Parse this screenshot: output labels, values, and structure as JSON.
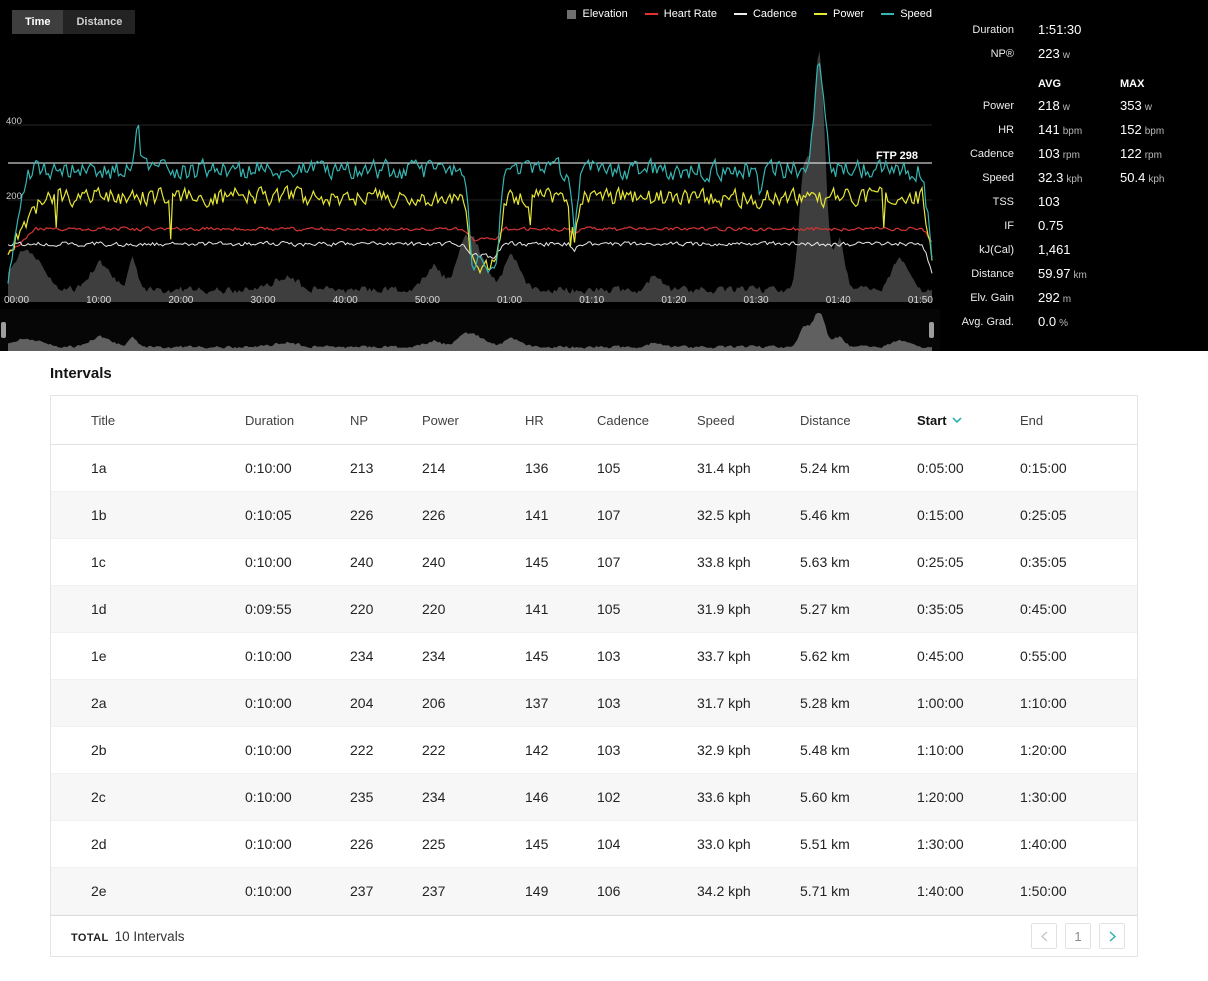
{
  "top_bar": {
    "time_label": "Time",
    "distance_label": "Distance"
  },
  "legend": [
    {
      "label": "Elevation",
      "color": "#6f6f6f",
      "swatch": "square"
    },
    {
      "label": "Heart Rate",
      "color": "#e03232",
      "swatch": "line"
    },
    {
      "label": "Cadence",
      "color": "#ededed",
      "swatch": "line"
    },
    {
      "label": "Power",
      "color": "#e6e635",
      "swatch": "line"
    },
    {
      "label": "Speed",
      "color": "#35b5b2",
      "swatch": "line"
    }
  ],
  "chart": {
    "ftp_label": "FTP 298",
    "y_ticks": [
      "400",
      "200"
    ],
    "x_ticks": [
      "00:00",
      "10:00",
      "20:00",
      "30:00",
      "40:00",
      "50:00",
      "01:00",
      "01:10",
      "01:20",
      "01:30",
      "01:40",
      "01:50"
    ]
  },
  "chart_data": {
    "type": "line",
    "x_axis": {
      "mode": "time",
      "ticks": [
        "00:00",
        "10:00",
        "20:00",
        "30:00",
        "40:00",
        "50:00",
        "01:00",
        "01:10",
        "01:20",
        "01:30",
        "01:40",
        "01:50"
      ],
      "duration": "1:51:30"
    },
    "y_axis": {
      "ticks": [
        400,
        200
      ],
      "range": [
        0,
        440
      ]
    },
    "ftp": 298,
    "series": [
      {
        "name": "Power",
        "avg": 218,
        "max": 353,
        "unit": "w",
        "color": "#e6e635"
      },
      {
        "name": "Heart Rate",
        "avg": 141,
        "max": 152,
        "unit": "bpm",
        "color": "#e03232"
      },
      {
        "name": "Cadence",
        "avg": 103,
        "max": 122,
        "unit": "rpm",
        "color": "#ededed"
      },
      {
        "name": "Speed",
        "avg": 32.3,
        "max": 50.4,
        "unit": "kph",
        "color": "#35b5b2"
      },
      {
        "name": "Elevation",
        "gain": 292,
        "unit": "m",
        "color": "#6f6f6f"
      }
    ],
    "legend_position": "top-right",
    "grid": true
  },
  "chart_render": {
    "main": [
      {
        "name": "elevation",
        "area": true,
        "color": "#8a8a8a",
        "opacity": 0.45,
        "seed": 11,
        "noise": 5,
        "base": 290,
        "spikes": [
          {
            "at": 0.02,
            "peak": 40,
            "w": 0.022
          },
          {
            "at": 0.1,
            "peak": 26,
            "w": 0.016
          },
          {
            "at": 0.135,
            "peak": 30,
            "w": 0.007
          },
          {
            "at": 0.3,
            "peak": 12,
            "w": 0.02
          },
          {
            "at": 0.46,
            "peak": 24,
            "w": 0.012
          },
          {
            "at": 0.5,
            "peak": 55,
            "w": 0.018
          },
          {
            "at": 0.545,
            "peak": 35,
            "w": 0.012
          },
          {
            "at": 0.7,
            "peak": 14,
            "w": 0.01
          },
          {
            "at": 0.862,
            "peak": 120,
            "w": 0.008
          },
          {
            "at": 0.878,
            "peak": 235,
            "w": 0.009
          },
          {
            "at": 0.9,
            "peak": 50,
            "w": 0.008
          },
          {
            "at": 0.965,
            "peak": 30,
            "w": 0.012
          }
        ]
      },
      {
        "name": "heart-rate",
        "color": "#d23434",
        "width": 1.2,
        "seed": 21,
        "noise": 2.5,
        "base": 229,
        "ramps": [
          {
            "to": 0.03,
            "drop": 25
          }
        ],
        "ends": [
          {
            "from": 0.99,
            "drop": 12
          }
        ],
        "dips": [
          {
            "from": 0.493,
            "to": 0.538,
            "drop": 11
          },
          {
            "from": 0.606,
            "to": 0.62,
            "drop": 7
          }
        ]
      },
      {
        "name": "cadence",
        "color": "#e8e8e8",
        "width": 1,
        "seed": 31,
        "noise": 3,
        "base": 244,
        "ends": [
          {
            "from": 0.99,
            "drop": 28
          }
        ],
        "dips": [
          {
            "from": 0.493,
            "to": 0.538,
            "drop": 12
          },
          {
            "from": 0.606,
            "to": 0.62,
            "drop": 9
          }
        ]
      },
      {
        "name": "power",
        "color": "#e6e635",
        "width": 1.2,
        "seed": 41,
        "noise": 12,
        "base": 197,
        "downspike": 0.012,
        "ramps": [
          {
            "to": 0.04,
            "drop": 52
          }
        ],
        "ends": [
          {
            "from": 0.99,
            "drop": 65
          }
        ],
        "dips": [
          {
            "from": 0.493,
            "to": 0.538,
            "drop": 70
          },
          {
            "from": 0.606,
            "to": 0.62,
            "drop": 65
          },
          {
            "from": 0.81,
            "to": 0.818,
            "drop": 45
          }
        ]
      },
      {
        "name": "speed",
        "color": "#35b5b2",
        "width": 1.2,
        "seed": 51,
        "noise": 13,
        "base": 170,
        "spikes": [
          {
            "at": 0.878,
            "peak": 108,
            "w": 0.008
          },
          {
            "at": 0.14,
            "peak": 40,
            "w": 0.004
          }
        ],
        "ramps": [
          {
            "to": 0.02,
            "drop": 120
          }
        ],
        "ends": [
          {
            "from": 0.99,
            "drop": 85
          }
        ],
        "dips": [
          {
            "from": 0.493,
            "to": 0.538,
            "drop": 95
          },
          {
            "from": 0.606,
            "to": 0.62,
            "drop": 85
          },
          {
            "from": 0.81,
            "to": 0.818,
            "drop": 60
          }
        ]
      }
    ],
    "minimap": [
      {
        "name": "elevation-mini",
        "area": true,
        "color": "#6a6a6a",
        "opacity": 0.9,
        "seed": 11,
        "noise": 2,
        "base": 38,
        "spikes": [
          {
            "at": 0.02,
            "peak": 8,
            "w": 0.022
          },
          {
            "at": 0.1,
            "peak": 10,
            "w": 0.016
          },
          {
            "at": 0.135,
            "peak": 9,
            "w": 0.007
          },
          {
            "at": 0.3,
            "peak": 4,
            "w": 0.02
          },
          {
            "at": 0.46,
            "peak": 6,
            "w": 0.012
          },
          {
            "at": 0.5,
            "peak": 14,
            "w": 0.018
          },
          {
            "at": 0.545,
            "peak": 9,
            "w": 0.012
          },
          {
            "at": 0.7,
            "peak": 4,
            "w": 0.01
          },
          {
            "at": 0.862,
            "peak": 20,
            "w": 0.008
          },
          {
            "at": 0.878,
            "peak": 36,
            "w": 0.009
          },
          {
            "at": 0.9,
            "peak": 10,
            "w": 0.008
          },
          {
            "at": 0.965,
            "peak": 6,
            "w": 0.012
          }
        ]
      }
    ]
  },
  "stats": {
    "rows_top": [
      {
        "label": "Duration",
        "value": "1:51:30",
        "unit": ""
      },
      {
        "label": "NP®",
        "value": "223",
        "unit": "w"
      }
    ],
    "avg_header": "AVG",
    "max_header": "MAX",
    "avgmax_rows": [
      {
        "label": "Power",
        "avg": "218",
        "avg_unit": "w",
        "max": "353",
        "max_unit": "w"
      },
      {
        "label": "HR",
        "avg": "141",
        "avg_unit": "bpm",
        "max": "152",
        "max_unit": "bpm"
      },
      {
        "label": "Cadence",
        "avg": "103",
        "avg_unit": "rpm",
        "max": "122",
        "max_unit": "rpm"
      },
      {
        "label": "Speed",
        "avg": "32.3",
        "avg_unit": "kph",
        "max": "50.4",
        "max_unit": "kph"
      }
    ],
    "rows_bottom": [
      {
        "label": "TSS",
        "value": "103",
        "unit": ""
      },
      {
        "label": "IF",
        "value": "0.75",
        "unit": ""
      },
      {
        "label": "kJ(Cal)",
        "value": "1,461",
        "unit": ""
      },
      {
        "label": "Distance",
        "value": "59.97",
        "unit": "km"
      },
      {
        "label": "Elv. Gain",
        "value": "292",
        "unit": "m"
      },
      {
        "label": "Avg. Grad.",
        "value": "0.0",
        "unit": "%"
      }
    ]
  },
  "intervals": {
    "title": "Intervals",
    "columns": [
      "Title",
      "Duration",
      "NP",
      "Power",
      "HR",
      "Cadence",
      "Speed",
      "Distance",
      "Start",
      "End"
    ],
    "sort_column": "Start",
    "sort_direction": "desc",
    "rows": [
      {
        "title": "1a",
        "duration": "0:10:00",
        "np": "213",
        "power": "214",
        "hr": "136",
        "cadence": "105",
        "speed": "31.4 kph",
        "distance": "5.24 km",
        "start": "0:05:00",
        "end": "0:15:00"
      },
      {
        "title": "1b",
        "duration": "0:10:05",
        "np": "226",
        "power": "226",
        "hr": "141",
        "cadence": "107",
        "speed": "32.5 kph",
        "distance": "5.46 km",
        "start": "0:15:00",
        "end": "0:25:05"
      },
      {
        "title": "1c",
        "duration": "0:10:00",
        "np": "240",
        "power": "240",
        "hr": "145",
        "cadence": "107",
        "speed": "33.8 kph",
        "distance": "5.63 km",
        "start": "0:25:05",
        "end": "0:35:05"
      },
      {
        "title": "1d",
        "duration": "0:09:55",
        "np": "220",
        "power": "220",
        "hr": "141",
        "cadence": "105",
        "speed": "31.9 kph",
        "distance": "5.27 km",
        "start": "0:35:05",
        "end": "0:45:00"
      },
      {
        "title": "1e",
        "duration": "0:10:00",
        "np": "234",
        "power": "234",
        "hr": "145",
        "cadence": "103",
        "speed": "33.7 kph",
        "distance": "5.62 km",
        "start": "0:45:00",
        "end": "0:55:00"
      },
      {
        "title": "2a",
        "duration": "0:10:00",
        "np": "204",
        "power": "206",
        "hr": "137",
        "cadence": "103",
        "speed": "31.7 kph",
        "distance": "5.28 km",
        "start": "1:00:00",
        "end": "1:10:00"
      },
      {
        "title": "2b",
        "duration": "0:10:00",
        "np": "222",
        "power": "222",
        "hr": "142",
        "cadence": "103",
        "speed": "32.9 kph",
        "distance": "5.48 km",
        "start": "1:10:00",
        "end": "1:20:00"
      },
      {
        "title": "2c",
        "duration": "0:10:00",
        "np": "235",
        "power": "234",
        "hr": "146",
        "cadence": "102",
        "speed": "33.6 kph",
        "distance": "5.60 km",
        "start": "1:20:00",
        "end": "1:30:00"
      },
      {
        "title": "2d",
        "duration": "0:10:00",
        "np": "226",
        "power": "225",
        "hr": "145",
        "cadence": "104",
        "speed": "33.0 kph",
        "distance": "5.51 km",
        "start": "1:30:00",
        "end": "1:40:00"
      },
      {
        "title": "2e",
        "duration": "0:10:00",
        "np": "237",
        "power": "237",
        "hr": "149",
        "cadence": "106",
        "speed": "34.2 kph",
        "distance": "5.71 km",
        "start": "1:40:00",
        "end": "1:50:00"
      }
    ],
    "footer": {
      "total_label": "TOTAL",
      "total_value": "10 Intervals",
      "page": "1"
    }
  },
  "colors": {
    "accent_teal": "#2fb3b0",
    "power_yellow": "#e6e635",
    "hr_red": "#e03232",
    "elevation_gray": "#6f6f6f"
  }
}
